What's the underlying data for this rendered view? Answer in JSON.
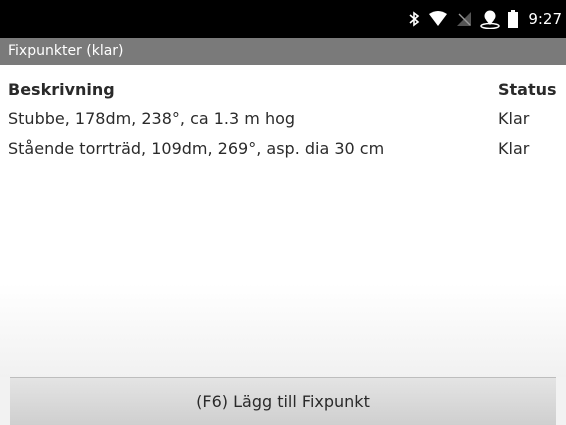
{
  "statusbar": {
    "time": "9:27",
    "icons": [
      "bluetooth-icon",
      "wifi-icon",
      "no-signal-icon",
      "location-icon",
      "battery-icon"
    ]
  },
  "screen": {
    "title": "Fixpunkter (klar)"
  },
  "table": {
    "columns": [
      "Beskrivning",
      "Status"
    ],
    "rows": [
      [
        "Stubbe, 178dm, 238°, ca 1.3 m hog",
        "Klar"
      ],
      [
        "Stående torrträd, 109dm, 269°, asp. dia 30 cm",
        "Klar"
      ]
    ]
  },
  "action": {
    "add_label": "(F6) Lägg till Fixpunkt"
  }
}
